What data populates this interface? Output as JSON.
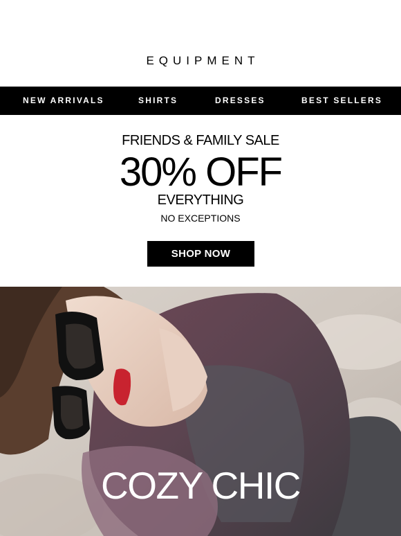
{
  "brand": {
    "name": "EQUIPMENT"
  },
  "nav": {
    "items": [
      {
        "label": "NEW ARRIVALS"
      },
      {
        "label": "SHIRTS"
      },
      {
        "label": "DRESSES"
      },
      {
        "label": "BEST SELLERS"
      }
    ]
  },
  "promo": {
    "kicker": "FRIENDS & FAMILY SALE",
    "headline": "30% OFF",
    "subline": "EVERYTHING",
    "note": "NO EXCEPTIONS",
    "cta_label": "SHOP NOW"
  },
  "hero": {
    "caption": "COZY CHIC",
    "image_icon": "model-photo"
  },
  "colors": {
    "background": "#ffffff",
    "nav_bg": "#000000",
    "cta_bg": "#000000",
    "text": "#000000",
    "caption": "#ffffff"
  }
}
